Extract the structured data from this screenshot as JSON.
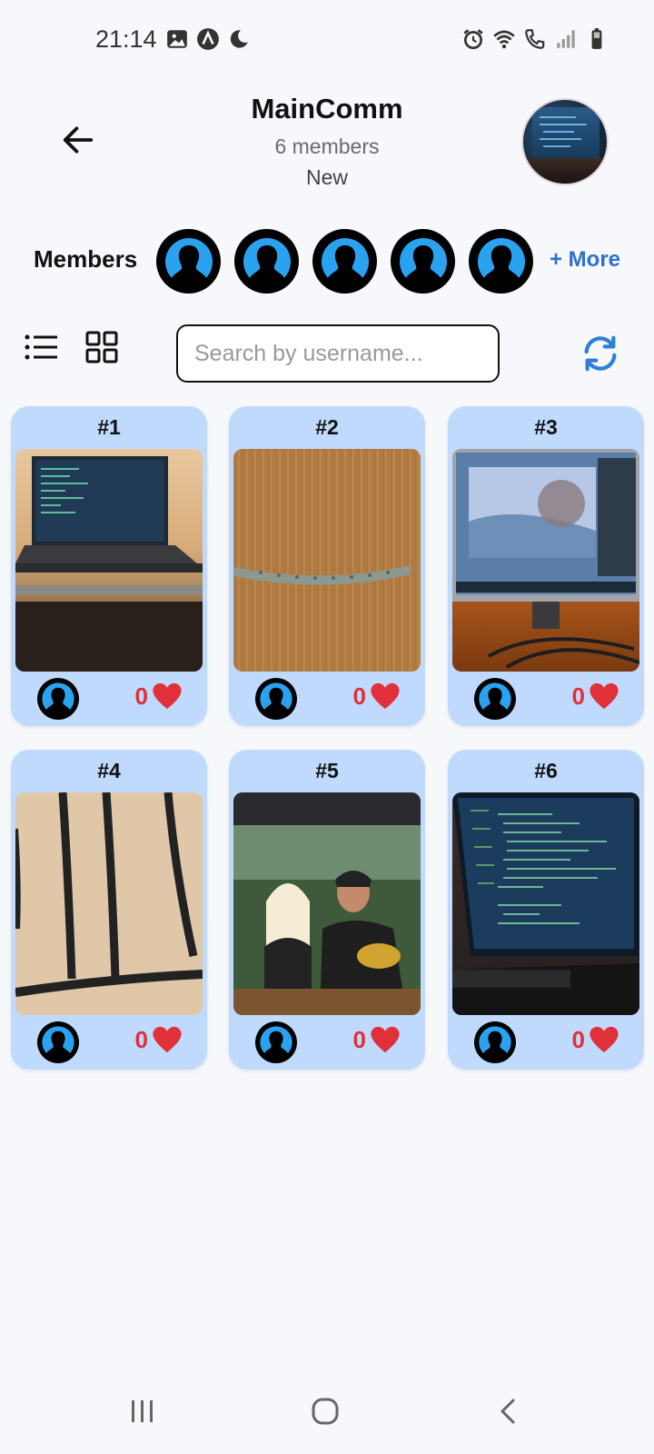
{
  "status_bar": {
    "time": "21:14"
  },
  "header": {
    "title": "MainComm",
    "member_count": "6 members",
    "status": "New"
  },
  "members": {
    "label": "Members",
    "more_link": "+ More",
    "visible_avatars": 5
  },
  "search": {
    "placeholder": "Search by username...",
    "value": ""
  },
  "posts": [
    {
      "number": "#1",
      "likes": "0",
      "image": "laptop-on-desk"
    },
    {
      "number": "#2",
      "likes": "0",
      "image": "wooden-door-handle"
    },
    {
      "number": "#3",
      "likes": "0",
      "image": "monitor-orange-wall"
    },
    {
      "number": "#4",
      "likes": "0",
      "image": "striped-fabric"
    },
    {
      "number": "#5",
      "likes": "0",
      "image": "tv-screen-couple"
    },
    {
      "number": "#6",
      "likes": "0",
      "image": "monitor-with-code"
    }
  ],
  "colors": {
    "card_bg": "#bfdafc",
    "accent": "#2f6fd1",
    "like_red": "#e0303a",
    "avatar_blue": "#29a3f0"
  },
  "icons": [
    "back-arrow-icon",
    "list-view-icon",
    "grid-view-icon",
    "refresh-icon",
    "heart-icon",
    "user-silhouette-icon"
  ]
}
